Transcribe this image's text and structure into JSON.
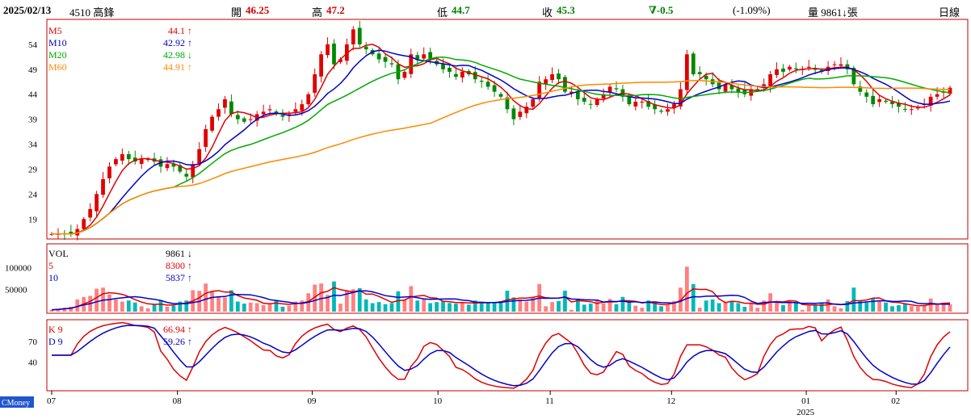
{
  "header": {
    "date": "2025/02/13",
    "stock": "4510 高鋒",
    "open_label": "開",
    "open_value": "46.25",
    "high_label": "高",
    "high_value": "47.2",
    "low_label": "低",
    "low_value": "44.7",
    "close_label": "收",
    "close_value": "45.3",
    "change": "∇-0.5",
    "change_pct": "(-1.09%)",
    "volume": "量 9861↓張",
    "period": "日線"
  },
  "corner_label": "CMoney",
  "chart_data": {
    "type": "candlestick",
    "date_range": [
      "2024/07",
      "2025/02/13"
    ],
    "x_ticks": [
      "07",
      "08",
      "09",
      "10",
      "11",
      "12",
      "01",
      "02"
    ],
    "x_sub_label": "2025",
    "colors": {
      "up": "#e00000",
      "down": "#008800",
      "ma5": "#e00000",
      "ma10": "#0000cc",
      "ma20": "#00aa00",
      "ma60": "#ff8800",
      "vol_up": "#ff8080",
      "vol_down": "#00b8b8",
      "k": "#e00000",
      "d": "#0000cc",
      "frame": "#c00000"
    },
    "price_panel": {
      "ylim": [
        15,
        59
      ],
      "y_ticks": [
        19,
        24,
        29,
        34,
        39,
        44,
        49,
        54
      ],
      "legend": [
        {
          "name": "M5",
          "value": "44.1",
          "arrow": "↑"
        },
        {
          "name": "M10",
          "value": "42.92",
          "arrow": "↑"
        },
        {
          "name": "M20",
          "value": "42.98",
          "arrow": "↓"
        },
        {
          "name": "M60",
          "value": "44.91",
          "arrow": "↑"
        }
      ],
      "close": [
        16,
        16,
        16,
        16,
        17,
        19,
        21,
        24,
        27,
        29.5,
        31,
        32,
        31,
        30.5,
        31,
        31,
        30.5,
        29.5,
        30,
        29.5,
        28.5,
        27.5,
        30,
        33,
        37,
        39.5,
        41,
        43,
        40,
        39,
        38.5,
        39,
        40,
        40.5,
        41,
        40,
        39.5,
        40,
        41,
        42,
        44,
        48,
        52,
        54,
        50,
        51,
        54,
        57,
        54,
        53,
        52,
        51,
        50.5,
        50,
        47,
        48.5,
        52,
        51,
        52,
        51,
        50,
        49,
        48.5,
        47.5,
        48.5,
        48,
        47,
        46.5,
        45.5,
        44.5,
        43.5,
        41,
        39,
        40.5,
        41.5,
        43,
        46.5,
        47,
        48,
        47,
        44.5,
        44.5,
        43,
        42.5,
        42,
        43,
        44,
        45.5,
        45,
        43.5,
        42,
        42.5,
        42.5,
        41.5,
        41,
        40.5,
        41,
        42,
        45,
        52,
        48,
        48,
        47,
        46,
        45,
        46,
        45,
        44.5,
        44,
        45,
        45,
        46,
        48,
        49,
        48.5,
        49.5,
        49,
        49,
        49.5,
        49,
        48.5,
        49.5,
        50,
        50,
        49,
        46,
        44.5,
        43.5,
        42,
        43,
        42.5,
        42,
        41.5,
        41,
        41,
        41.5,
        42,
        43.5,
        44,
        44.5,
        45.3
      ],
      "ma5_last": 44.1,
      "ma10_last": 42.92,
      "ma20_last": 42.98,
      "ma60_last": 44.91
    },
    "volume_panel": {
      "ylim": [
        0,
        150000
      ],
      "y_ticks": [
        50000,
        100000
      ],
      "y_tick_labels": [
        "50000",
        "100000"
      ],
      "legend": [
        {
          "name": "VOL",
          "value": "9861",
          "arrow": "↓"
        },
        {
          "name": "5",
          "value": "8300",
          "arrow": "↑"
        },
        {
          "name": "10",
          "value": "5837",
          "arrow": "↑"
        }
      ]
    },
    "kd_panel": {
      "ylim": [
        0,
        100
      ],
      "y_ticks": [
        40,
        70
      ],
      "legend": [
        {
          "name": "K 9",
          "value": "66.94",
          "arrow": "↑"
        },
        {
          "name": "D 9",
          "value": "59.26",
          "arrow": "↑"
        }
      ]
    }
  }
}
